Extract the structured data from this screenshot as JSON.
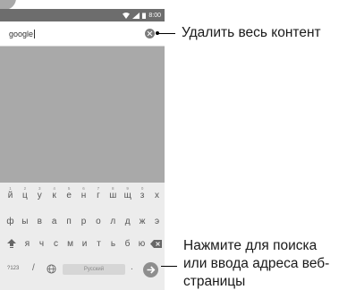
{
  "status_bar": {
    "time": "8:00"
  },
  "search": {
    "value": "google"
  },
  "keyboard": {
    "row1": [
      {
        "key": "й",
        "hint": "1"
      },
      {
        "key": "ц",
        "hint": "2"
      },
      {
        "key": "у",
        "hint": "3"
      },
      {
        "key": "к",
        "hint": "4"
      },
      {
        "key": "е",
        "hint": "5"
      },
      {
        "key": "н",
        "hint": "6"
      },
      {
        "key": "г",
        "hint": "7"
      },
      {
        "key": "ш",
        "hint": "8"
      },
      {
        "key": "щ",
        "hint": "9"
      },
      {
        "key": "з",
        "hint": "0"
      },
      {
        "key": "х",
        "hint": ""
      }
    ],
    "row2": [
      "ф",
      "ы",
      "в",
      "а",
      "п",
      "р",
      "о",
      "л",
      "д",
      "ж",
      "э"
    ],
    "row3": [
      "я",
      "ч",
      "с",
      "м",
      "и",
      "т",
      "ь",
      "б",
      "ю"
    ],
    "sym_label": "?123",
    "slash_label": "/",
    "space_label": "Русский",
    "period_label": "."
  },
  "callouts": {
    "clear": "Удалить весь контент",
    "go_line1": "Нажмите для поиска",
    "go_line2": "или ввода адреса веб-",
    "go_line3": "страницы"
  }
}
